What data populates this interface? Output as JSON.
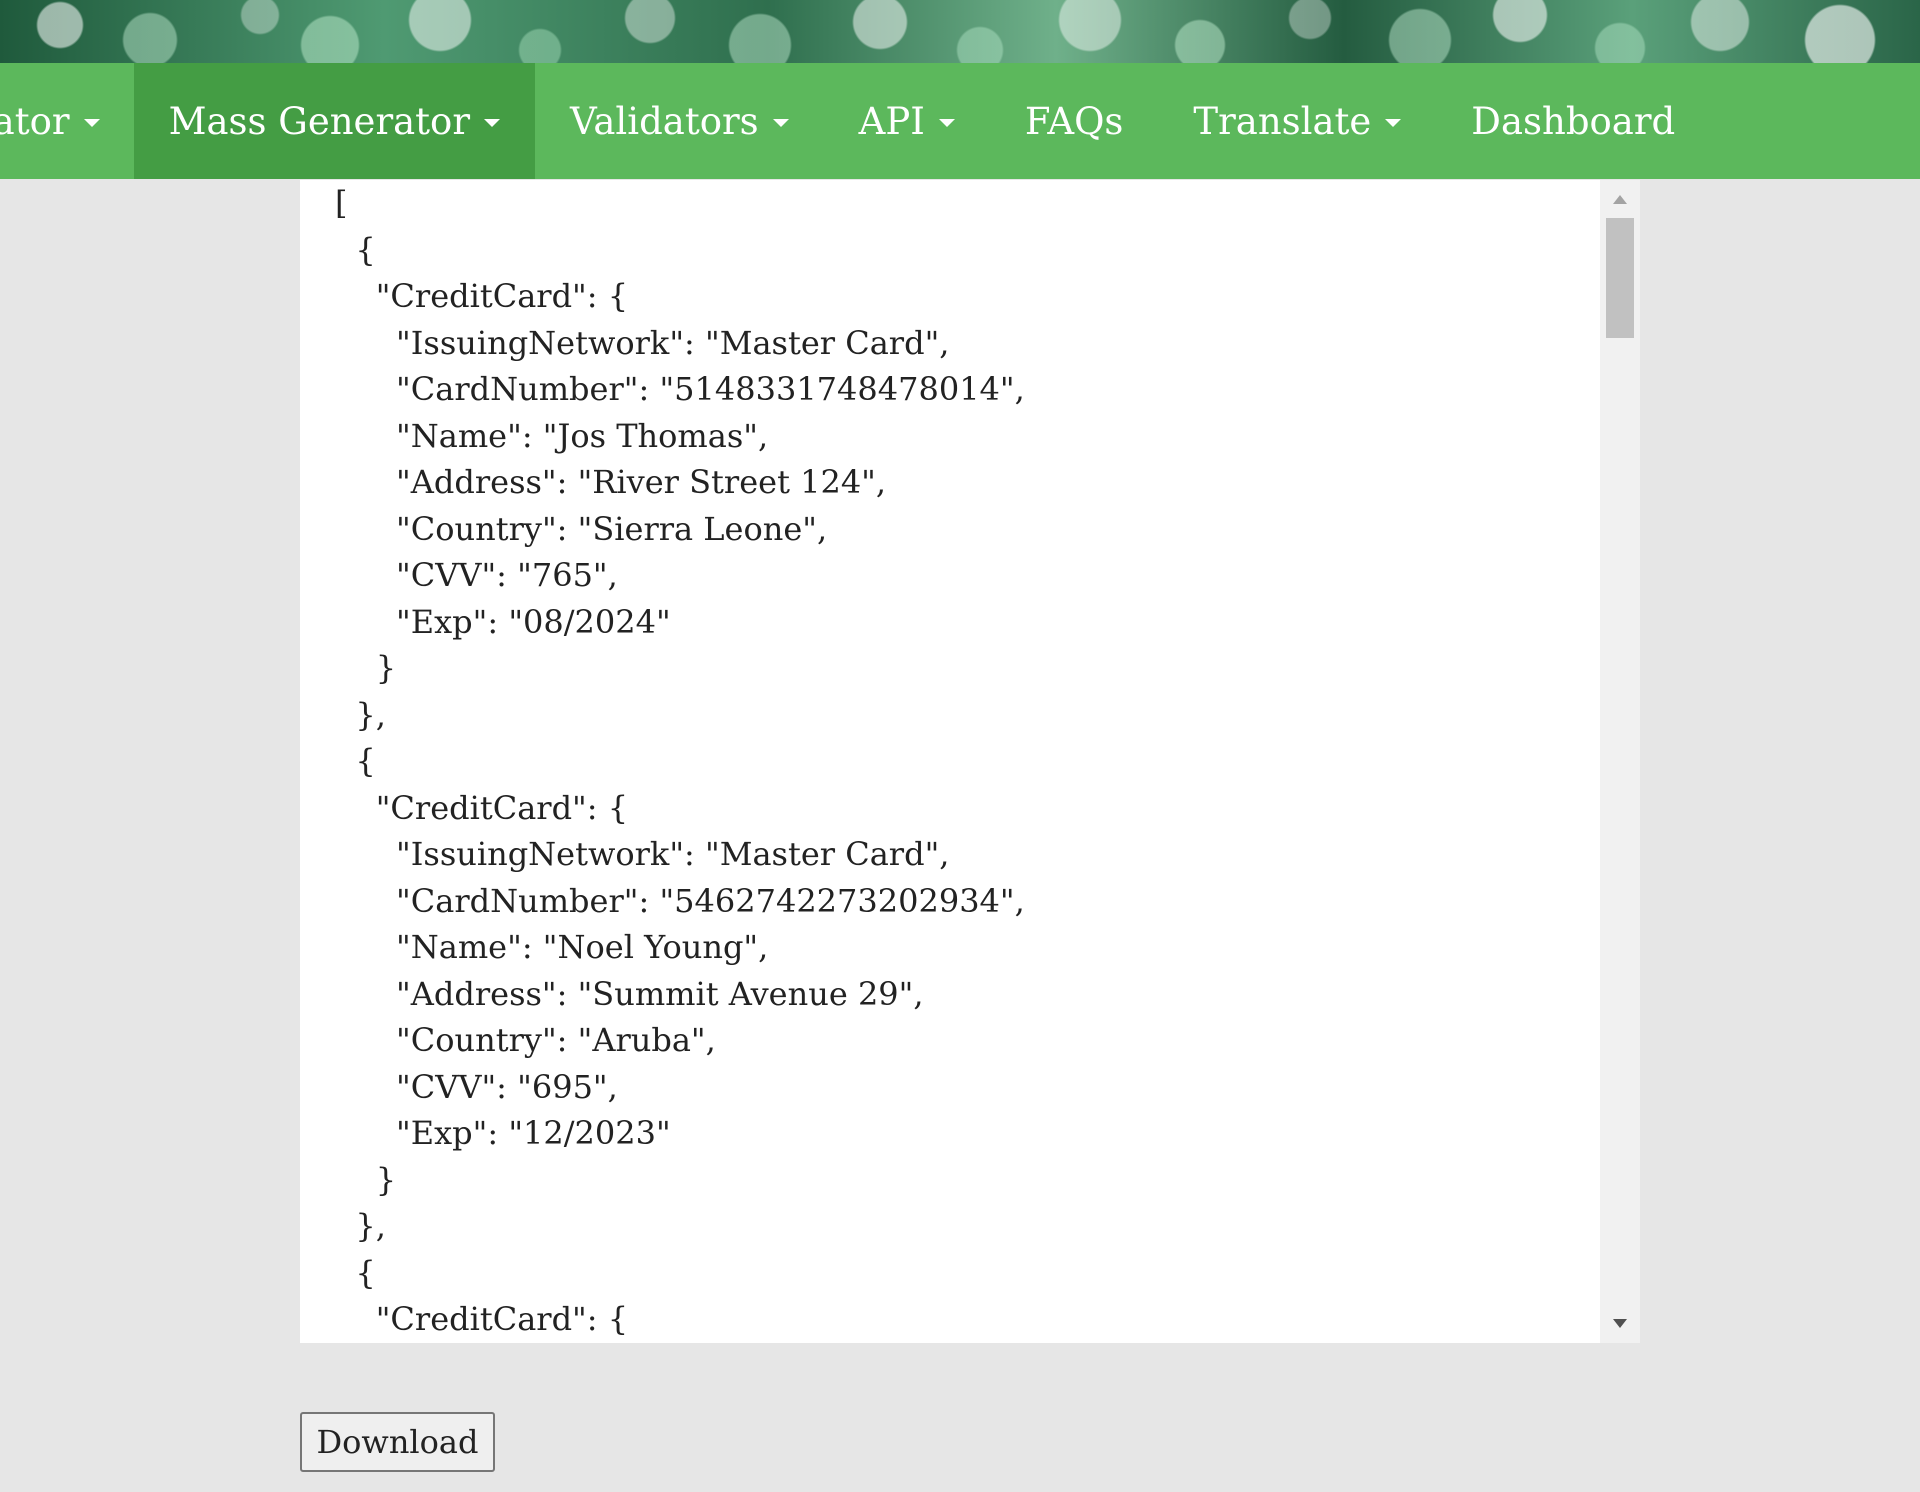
{
  "nav": {
    "items": [
      {
        "label": "rator",
        "dropdown": true,
        "active": false
      },
      {
        "label": "Mass Generator",
        "dropdown": true,
        "active": true
      },
      {
        "label": "Validators",
        "dropdown": true,
        "active": false
      },
      {
        "label": "API",
        "dropdown": true,
        "active": false
      },
      {
        "label": "FAQs",
        "dropdown": false,
        "active": false
      },
      {
        "label": "Translate",
        "dropdown": true,
        "active": false
      },
      {
        "label": "Dashboard",
        "dropdown": false,
        "active": false
      }
    ]
  },
  "output": {
    "json_text": "[\n  {\n    \"CreditCard\": {\n      \"IssuingNetwork\": \"Master Card\",\n      \"CardNumber\": \"5148331748478014\",\n      \"Name\": \"Jos Thomas\",\n      \"Address\": \"River Street 124\",\n      \"Country\": \"Sierra Leone\",\n      \"CVV\": \"765\",\n      \"Exp\": \"08/2024\"\n    }\n  },\n  {\n    \"CreditCard\": {\n      \"IssuingNetwork\": \"Master Card\",\n      \"CardNumber\": \"5462742273202934\",\n      \"Name\": \"Noel Young\",\n      \"Address\": \"Summit Avenue 29\",\n      \"Country\": \"Aruba\",\n      \"CVV\": \"695\",\n      \"Exp\": \"12/2023\"\n    }\n  },\n  {\n    \"CreditCard\": {"
  },
  "download": {
    "label": "Download"
  },
  "colors": {
    "nav_background": "#5cb85c",
    "nav_active": "#449d44",
    "page_background": "#e6e6e6"
  }
}
